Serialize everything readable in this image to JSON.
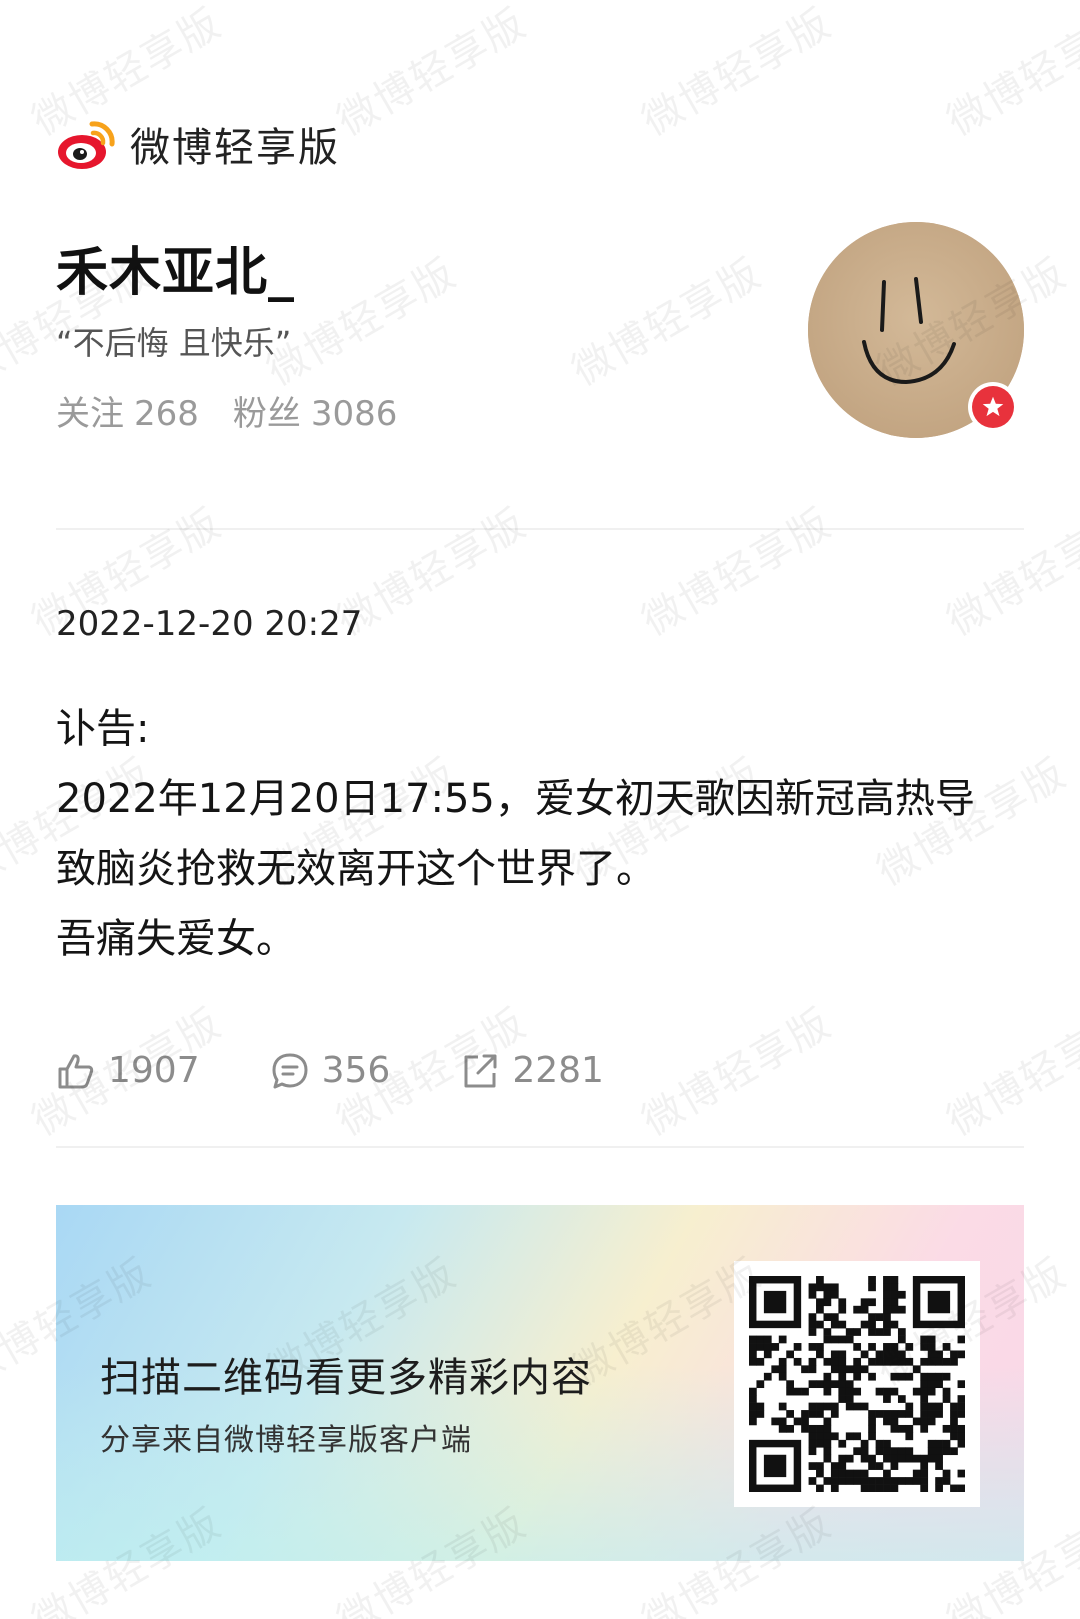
{
  "app": {
    "name": "微博轻享版",
    "logo_icon": "weibo-logo-icon"
  },
  "profile": {
    "username": "禾木亚北_",
    "bio": "“不后悔 且快乐”",
    "following_label": "关注",
    "following_count": "268",
    "followers_label": "粉丝",
    "followers_count": "3086",
    "avatar_icon": "smiley-face-icon",
    "badge_icon": "star-badge-icon"
  },
  "post": {
    "timestamp": "2022-12-20 20:27",
    "lines": [
      "讣告:",
      "2022年12月20日17:55，爱女初天歌因新冠高热导",
      "致脑炎抢救无效离开这个世界了。",
      "吾痛失爱女。"
    ],
    "likes": "1907",
    "comments": "356",
    "reposts": "2281"
  },
  "share_card": {
    "title": "扫描二维码看更多精彩内容",
    "subtitle": "分享来自微博轻享版客户端",
    "qr_icon": "qr-code-icon"
  },
  "watermark_text": "微博轻享版",
  "colors": {
    "badge_red": "#e8323c",
    "logo_red": "#e6162d",
    "logo_orange": "#f7a21b"
  }
}
